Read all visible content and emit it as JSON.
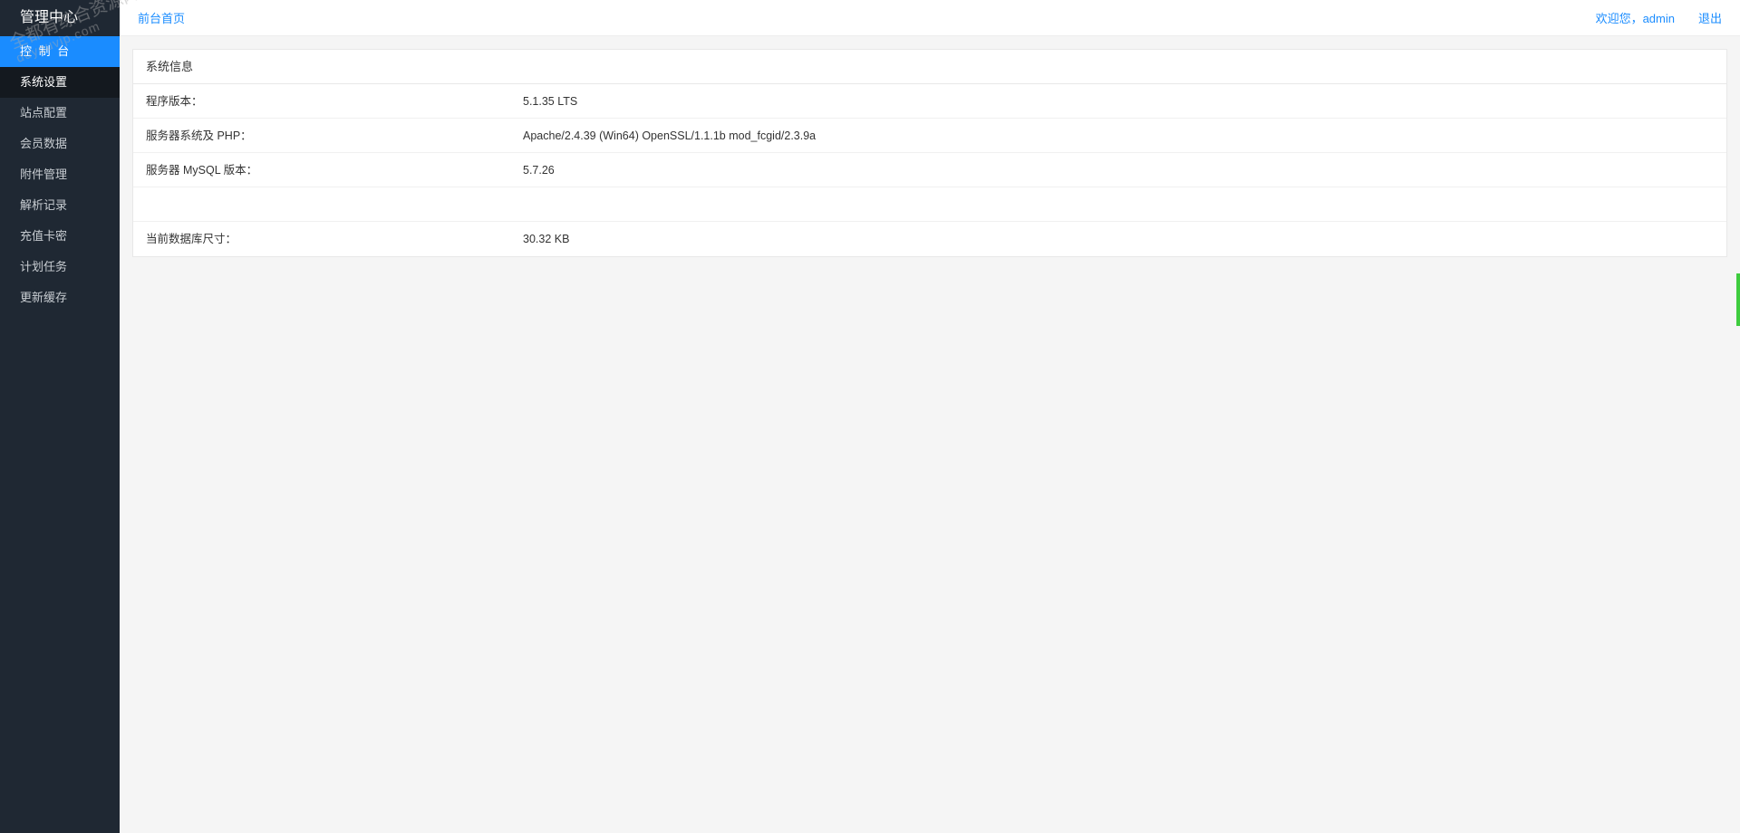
{
  "sidebar": {
    "title": "管理中心",
    "items": [
      {
        "label": "控 制 台",
        "state": "active"
      },
      {
        "label": "系统设置",
        "state": "dark"
      },
      {
        "label": "站点配置",
        "state": ""
      },
      {
        "label": "会员数据",
        "state": ""
      },
      {
        "label": "附件管理",
        "state": ""
      },
      {
        "label": "解析记录",
        "state": ""
      },
      {
        "label": "充值卡密",
        "state": ""
      },
      {
        "label": "计划任务",
        "state": ""
      },
      {
        "label": "更新缓存",
        "state": ""
      }
    ]
  },
  "topbar": {
    "home": "前台首页",
    "welcome": "欢迎您，admin",
    "logout": "退出"
  },
  "panel": {
    "title": "系统信息",
    "rows": [
      {
        "label": "程序版本：",
        "value": "5.1.35 LTS"
      },
      {
        "label": "服务器系统及 PHP：",
        "value": "Apache/2.4.39 (Win64) OpenSSL/1.1.1b mod_fcgid/2.3.9a"
      },
      {
        "label": "服务器 MySQL 版本：",
        "value": "5.7.26"
      }
    ],
    "rows2": [
      {
        "label": "当前数据库尺寸：",
        "value": "30.32 KB"
      }
    ]
  },
  "watermark": {
    "line1": "全都有综合资源网",
    "line2": "duyouvip.com"
  }
}
